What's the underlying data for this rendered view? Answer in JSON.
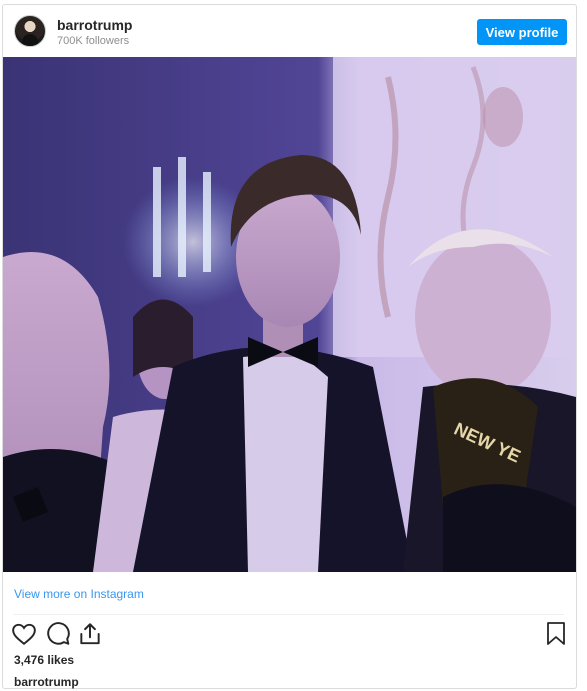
{
  "header": {
    "username": "barrotrump",
    "followers": "700K followers",
    "view_profile_label": "View profile"
  },
  "media": {
    "hat_text": "NEW YE"
  },
  "footer": {
    "view_more_label": "View more on Instagram",
    "likes": "3,476 likes",
    "caption_username": "barrotrump"
  },
  "icons": [
    "heart-icon",
    "comment-icon",
    "share-icon",
    "bookmark-icon"
  ],
  "colors": {
    "button_blue": "#0095f6",
    "link_blue": "#3897f0",
    "text_dark": "#262626",
    "text_muted": "#8e8e8e"
  }
}
